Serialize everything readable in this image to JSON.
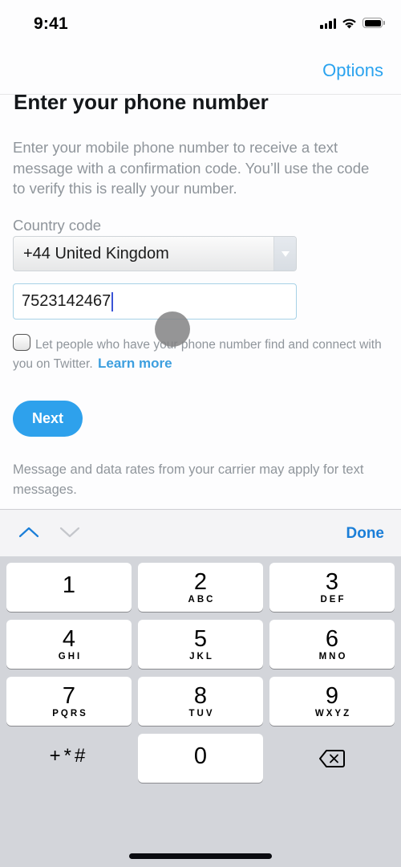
{
  "status_bar": {
    "time": "9:41",
    "icons": [
      "signal-icon",
      "wifi-icon",
      "battery-icon"
    ]
  },
  "nav": {
    "options_label": "Options"
  },
  "page": {
    "title": "Enter your phone number",
    "description": "Enter your mobile phone number to receive a text message with a confirmation code. You’ll use the code to verify this is really your number.",
    "country_code_label": "Country code",
    "country_code_value": "+44 United Kingdom",
    "phone_value": "7523142467",
    "discoverability_text": "Let people who have your phone number find and connect with you on Twitter.",
    "learn_more_label": "Learn more",
    "next_label": "Next",
    "footnote": "Message and data rates from your carrier may apply for text messages."
  },
  "accessory_bar": {
    "done_label": "Done",
    "icons": [
      "chevron-up-icon",
      "chevron-down-icon"
    ]
  },
  "keypad": {
    "keys": [
      {
        "num": "1",
        "letters": ""
      },
      {
        "num": "2",
        "letters": "ABC"
      },
      {
        "num": "3",
        "letters": "DEF"
      },
      {
        "num": "4",
        "letters": "GHI"
      },
      {
        "num": "5",
        "letters": "JKL"
      },
      {
        "num": "6",
        "letters": "MNO"
      },
      {
        "num": "7",
        "letters": "PQRS"
      },
      {
        "num": "8",
        "letters": "TUV"
      },
      {
        "num": "9",
        "letters": "WXYZ"
      },
      {
        "num": "0",
        "letters": ""
      }
    ],
    "symbols_label": "+*#",
    "delete_icon": "backspace-icon"
  },
  "colors": {
    "accent": "#2ea1ec",
    "link": "#3d9fdf",
    "done": "#1a7ed8",
    "muted_text": "#8f959b"
  }
}
